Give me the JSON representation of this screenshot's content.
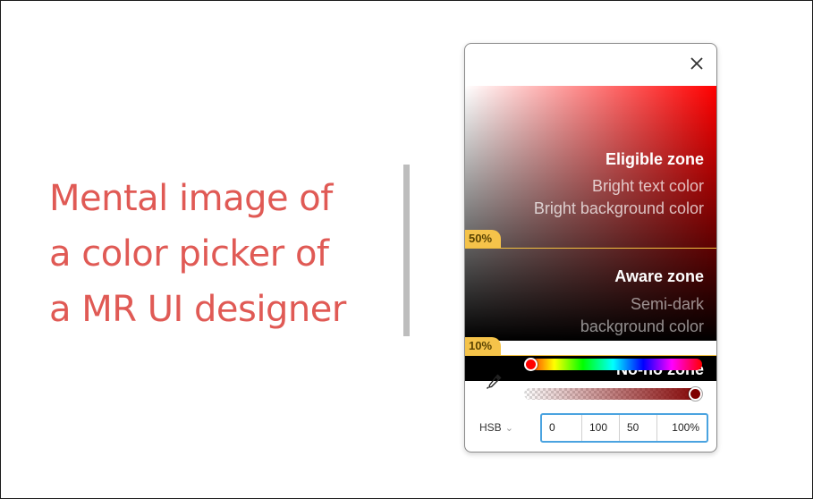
{
  "caption": {
    "lines": [
      "Mental image of",
      "a color picker of",
      "a MR UI designer"
    ],
    "color": "#e05a55"
  },
  "picker": {
    "close_icon": "close-icon",
    "zones": {
      "eligible": {
        "title": "Eligible zone",
        "desc_line1": "Bright text color",
        "desc_line2": "Bright background color",
        "badge": "50%"
      },
      "aware": {
        "title": "Aware zone",
        "desc_line1": "Semi-dark",
        "desc_line2": "background color",
        "badge": "10%"
      },
      "nono": {
        "title": "No-no zone"
      }
    },
    "zone_line_color": "#f2c040",
    "badge_color": "#f5c34a",
    "eyedropper_icon": "eyedropper-icon",
    "hue_position": 0.0,
    "alpha_position": 1.0,
    "mode": {
      "label": "HSB",
      "chevron": "⌄"
    },
    "values": [
      "0",
      "100",
      "50",
      "100%"
    ],
    "focus_color": "#4aa3e0"
  }
}
